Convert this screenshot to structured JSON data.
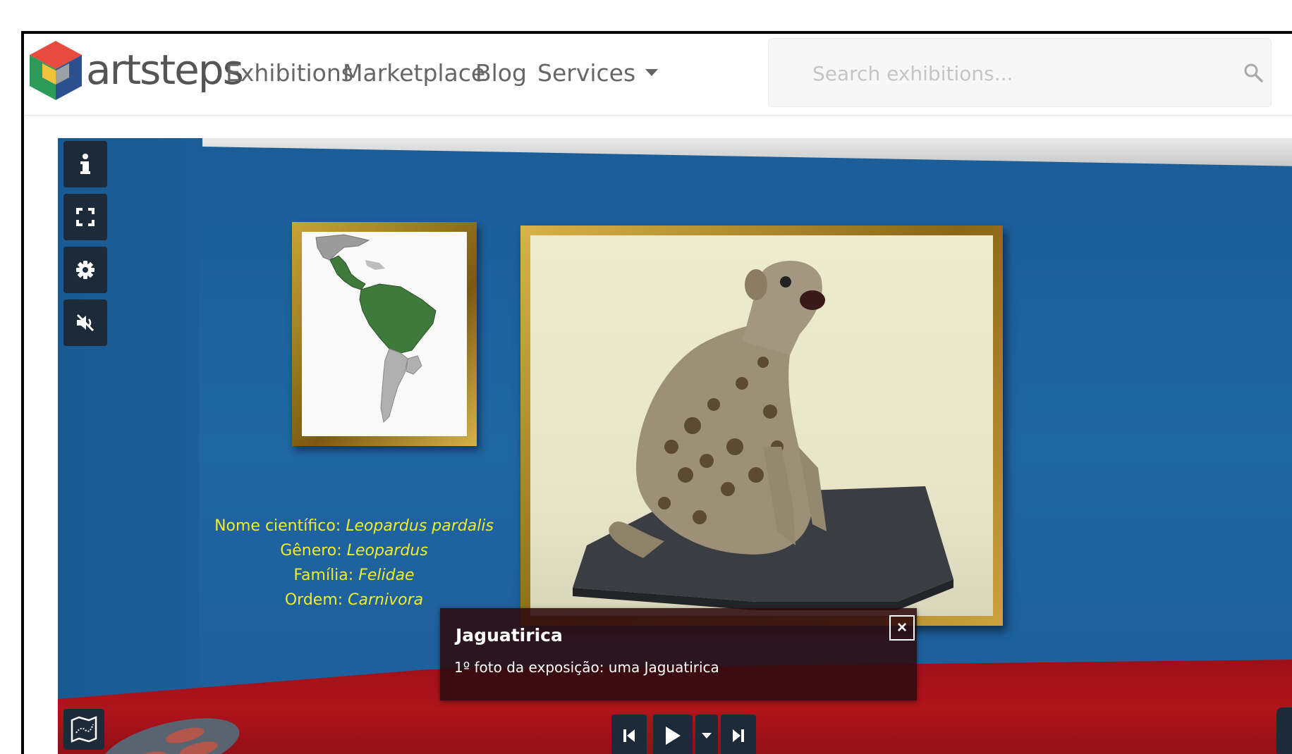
{
  "brand": {
    "name": "artsteps"
  },
  "nav": {
    "exhibitions": "Exhibitions",
    "marketplace": "Marketplace",
    "blog": "Blog",
    "services": "Services"
  },
  "search": {
    "placeholder": "Search exhibitions..."
  },
  "viewer": {
    "toolbar": [
      "info-icon",
      "fullscreen-icon",
      "settings-gear-icon",
      "mute-icon"
    ],
    "caption": {
      "line1_label": "Nome científico: ",
      "line1_value": "Leopardus pardalis",
      "line2_label": "Gênero: ",
      "line2_value": "Leopardus",
      "line3_label": "Família: ",
      "line3_value": "Felidae",
      "line4_label": "Ordem: ",
      "line4_value": "Carnivora"
    },
    "popup": {
      "title": "Jaguatirica",
      "description": "1º foto da exposição: uma Jaguatirica",
      "close": "×"
    },
    "player": [
      "previous-icon",
      "play-icon",
      "dropdown-icon",
      "next-icon"
    ]
  },
  "colors": {
    "wall": "#1d5d94",
    "floor": "#a8131b",
    "caption_text": "#f0ec2a",
    "toolbar_bg": "#1c2a3a"
  }
}
